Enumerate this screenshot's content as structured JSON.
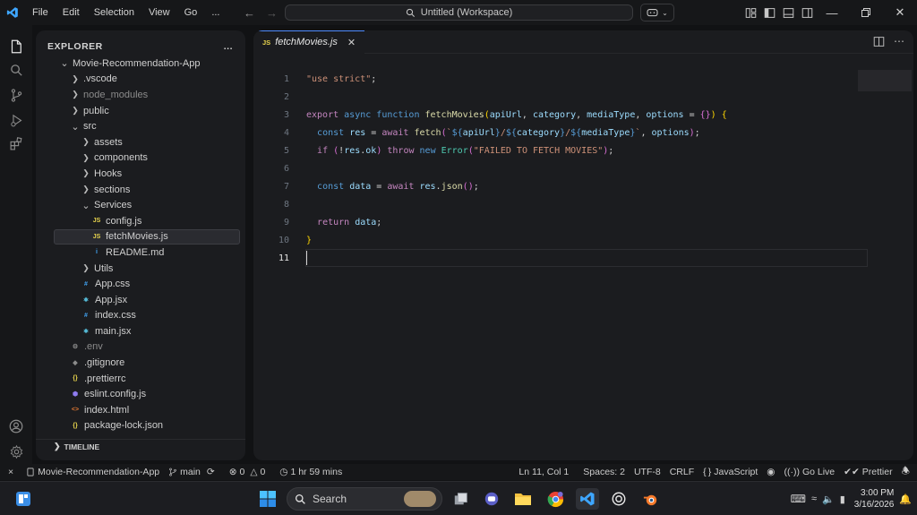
{
  "titlebar": {
    "menu": [
      "File",
      "Edit",
      "Selection",
      "View",
      "Go",
      "..."
    ],
    "command_center": "Untitled (Workspace)"
  },
  "explorer": {
    "title": "EXPLORER",
    "more": "...",
    "tree": [
      {
        "label": "Movie-Recommendation-App",
        "type": "folder-open",
        "depth": 0
      },
      {
        "label": ".vscode",
        "type": "folder",
        "depth": 1
      },
      {
        "label": "node_modules",
        "type": "folder",
        "depth": 1,
        "dim": true
      },
      {
        "label": "public",
        "type": "folder",
        "depth": 1
      },
      {
        "label": "src",
        "type": "folder-open",
        "depth": 1
      },
      {
        "label": "assets",
        "type": "folder",
        "depth": 2
      },
      {
        "label": "components",
        "type": "folder",
        "depth": 2
      },
      {
        "label": "Hooks",
        "type": "folder",
        "depth": 2
      },
      {
        "label": "sections",
        "type": "folder",
        "depth": 2
      },
      {
        "label": "Services",
        "type": "folder-open",
        "depth": 2
      },
      {
        "label": "config.js",
        "type": "js",
        "depth": 3
      },
      {
        "label": "fetchMovies.js",
        "type": "js",
        "depth": 3,
        "selected": true
      },
      {
        "label": "README.md",
        "type": "info",
        "depth": 3
      },
      {
        "label": "Utils",
        "type": "folder",
        "depth": 2
      },
      {
        "label": "App.css",
        "type": "css",
        "depth": 2
      },
      {
        "label": "App.jsx",
        "type": "jsx",
        "depth": 2
      },
      {
        "label": "index.css",
        "type": "css",
        "depth": 2
      },
      {
        "label": "main.jsx",
        "type": "jsx",
        "depth": 2
      },
      {
        "label": ".env",
        "type": "env",
        "depth": 1,
        "dim": true
      },
      {
        "label": ".gitignore",
        "type": "git",
        "depth": 1
      },
      {
        "label": ".prettierrc",
        "type": "json",
        "depth": 1
      },
      {
        "label": "eslint.config.js",
        "type": "eslint",
        "depth": 1
      },
      {
        "label": "index.html",
        "type": "html",
        "depth": 1
      },
      {
        "label": "package-lock.json",
        "type": "json",
        "depth": 1
      }
    ],
    "timeline": "TIMELINE"
  },
  "editor": {
    "tab": {
      "icon": "JS",
      "name": "fetchMovies.js"
    },
    "lines": [
      {
        "n": "1",
        "tokens": [
          [
            "str",
            "\"use strict\""
          ],
          [
            "",
            ";"
          ]
        ]
      },
      {
        "n": "2",
        "tokens": []
      },
      {
        "n": "3",
        "tokens": [
          [
            "kw",
            "export"
          ],
          [
            "",
            " "
          ],
          [
            "decl",
            "async"
          ],
          [
            "",
            " "
          ],
          [
            "decl",
            "function"
          ],
          [
            "",
            " "
          ],
          [
            "fn",
            "fetchMovies"
          ],
          [
            "br",
            "("
          ],
          [
            "var",
            "apiUrl"
          ],
          [
            "",
            ", "
          ],
          [
            "var",
            "category"
          ],
          [
            "",
            ", "
          ],
          [
            "var",
            "mediaType"
          ],
          [
            "",
            ", "
          ],
          [
            "var",
            "options"
          ],
          [
            "",
            " = "
          ],
          [
            "br2",
            "{}"
          ],
          [
            "br",
            ")"
          ],
          [
            "",
            " "
          ],
          [
            "br",
            "{"
          ]
        ]
      },
      {
        "n": "4",
        "tokens": [
          [
            "",
            "  "
          ],
          [
            "decl",
            "const"
          ],
          [
            "",
            " "
          ],
          [
            "var",
            "res"
          ],
          [
            "",
            " = "
          ],
          [
            "kw",
            "await"
          ],
          [
            "",
            " "
          ],
          [
            "fn",
            "fetch"
          ],
          [
            "br2",
            "("
          ],
          [
            "str",
            "`"
          ],
          [
            "tmpl",
            "${"
          ],
          [
            "var",
            "apiUrl"
          ],
          [
            "tmpl",
            "}"
          ],
          [
            "str",
            "/"
          ],
          [
            "tmpl",
            "${"
          ],
          [
            "var",
            "category"
          ],
          [
            "tmpl",
            "}"
          ],
          [
            "str",
            "/"
          ],
          [
            "tmpl",
            "${"
          ],
          [
            "var",
            "mediaType"
          ],
          [
            "tmpl",
            "}"
          ],
          [
            "str",
            "`"
          ],
          [
            "",
            ", "
          ],
          [
            "var",
            "options"
          ],
          [
            "br2",
            ")"
          ],
          [
            "",
            ";"
          ]
        ]
      },
      {
        "n": "5",
        "tokens": [
          [
            "",
            "  "
          ],
          [
            "kw",
            "if"
          ],
          [
            "",
            " "
          ],
          [
            "br2",
            "("
          ],
          [
            "",
            "!"
          ],
          [
            "var",
            "res"
          ],
          [
            "",
            "."
          ],
          [
            "var",
            "ok"
          ],
          [
            "br2",
            ")"
          ],
          [
            "",
            " "
          ],
          [
            "kw",
            "throw"
          ],
          [
            "",
            " "
          ],
          [
            "decl",
            "new"
          ],
          [
            "",
            " "
          ],
          [
            "cls",
            "Error"
          ],
          [
            "br2",
            "("
          ],
          [
            "str",
            "\"FAILED TO FETCH MOVIES\""
          ],
          [
            "br2",
            ")"
          ],
          [
            "",
            ";"
          ]
        ]
      },
      {
        "n": "6",
        "tokens": []
      },
      {
        "n": "7",
        "tokens": [
          [
            "",
            "  "
          ],
          [
            "decl",
            "const"
          ],
          [
            "",
            " "
          ],
          [
            "var",
            "data"
          ],
          [
            "",
            " = "
          ],
          [
            "kw",
            "await"
          ],
          [
            "",
            " "
          ],
          [
            "var",
            "res"
          ],
          [
            "",
            "."
          ],
          [
            "fn",
            "json"
          ],
          [
            "br2",
            "()"
          ],
          [
            "",
            ";"
          ]
        ]
      },
      {
        "n": "8",
        "tokens": []
      },
      {
        "n": "9",
        "tokens": [
          [
            "",
            "  "
          ],
          [
            "kw",
            "return"
          ],
          [
            "",
            " "
          ],
          [
            "var",
            "data"
          ],
          [
            "",
            ";"
          ]
        ]
      },
      {
        "n": "10",
        "tokens": [
          [
            "br",
            "}"
          ]
        ]
      },
      {
        "n": "11",
        "tokens": [],
        "current": true
      }
    ]
  },
  "statusbar": {
    "remote": "×",
    "project": "Movie-Recommendation-App",
    "branch": "main",
    "problems": "0",
    "warnings": "0",
    "time": "1 hr 59 mins",
    "position": "Ln 11, Col 1",
    "spaces": "Spaces: 2",
    "encoding": "UTF-8",
    "eol": "CRLF",
    "language": "JavaScript",
    "golive": "Go Live",
    "prettier": "Prettier"
  },
  "taskbar": {
    "search_placeholder": "Search",
    "time": "3:00 PM",
    "date": "3/16/2026"
  },
  "colors": {
    "accent": "#4f8cff",
    "vscode_blue": "#3ea6ff",
    "folder": "#bbbbbb",
    "js_icon": "#e8d44d"
  }
}
